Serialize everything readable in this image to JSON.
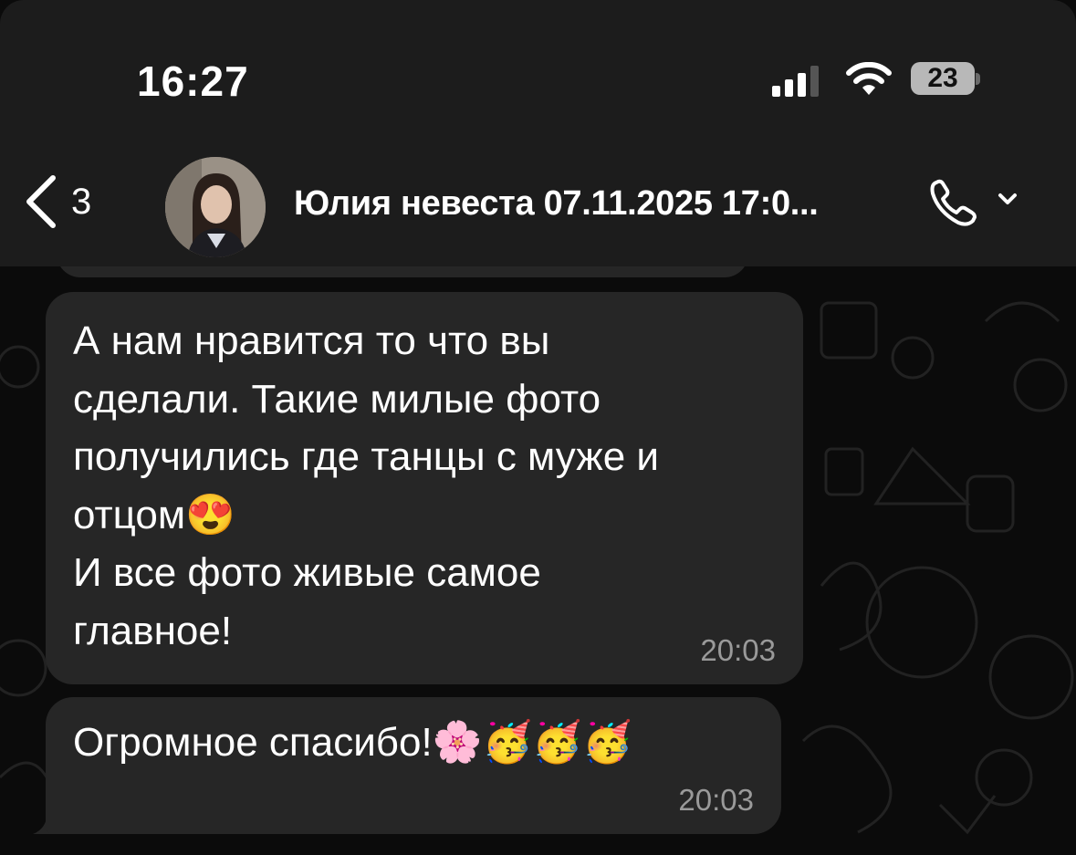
{
  "status_bar": {
    "time": "16:27",
    "battery_level": "23",
    "icons": [
      "signal-icon",
      "wifi-icon",
      "battery-icon"
    ]
  },
  "header": {
    "back_count": "3",
    "contact_name": "Юлия невеста 07.11.2025 17:0...",
    "icons": [
      "back-chevron-icon",
      "phone-icon",
      "chevron-down-icon"
    ]
  },
  "messages": [
    {
      "text": "А нам нравится то что вы\nсделали. Такие милые фото\nполучились где танцы с муже и\nотцом😍\nИ все фото живые самое\nглавное!",
      "time": "20:03"
    },
    {
      "text": "Огромное спасибо!🌸🥳🥳🥳",
      "time": "20:03"
    }
  ],
  "colors": {
    "bar_background": "#1c1c1c",
    "bubble_background": "#262626",
    "chat_background": "#0b0b0b",
    "timestamp": "#9a9a9a"
  }
}
